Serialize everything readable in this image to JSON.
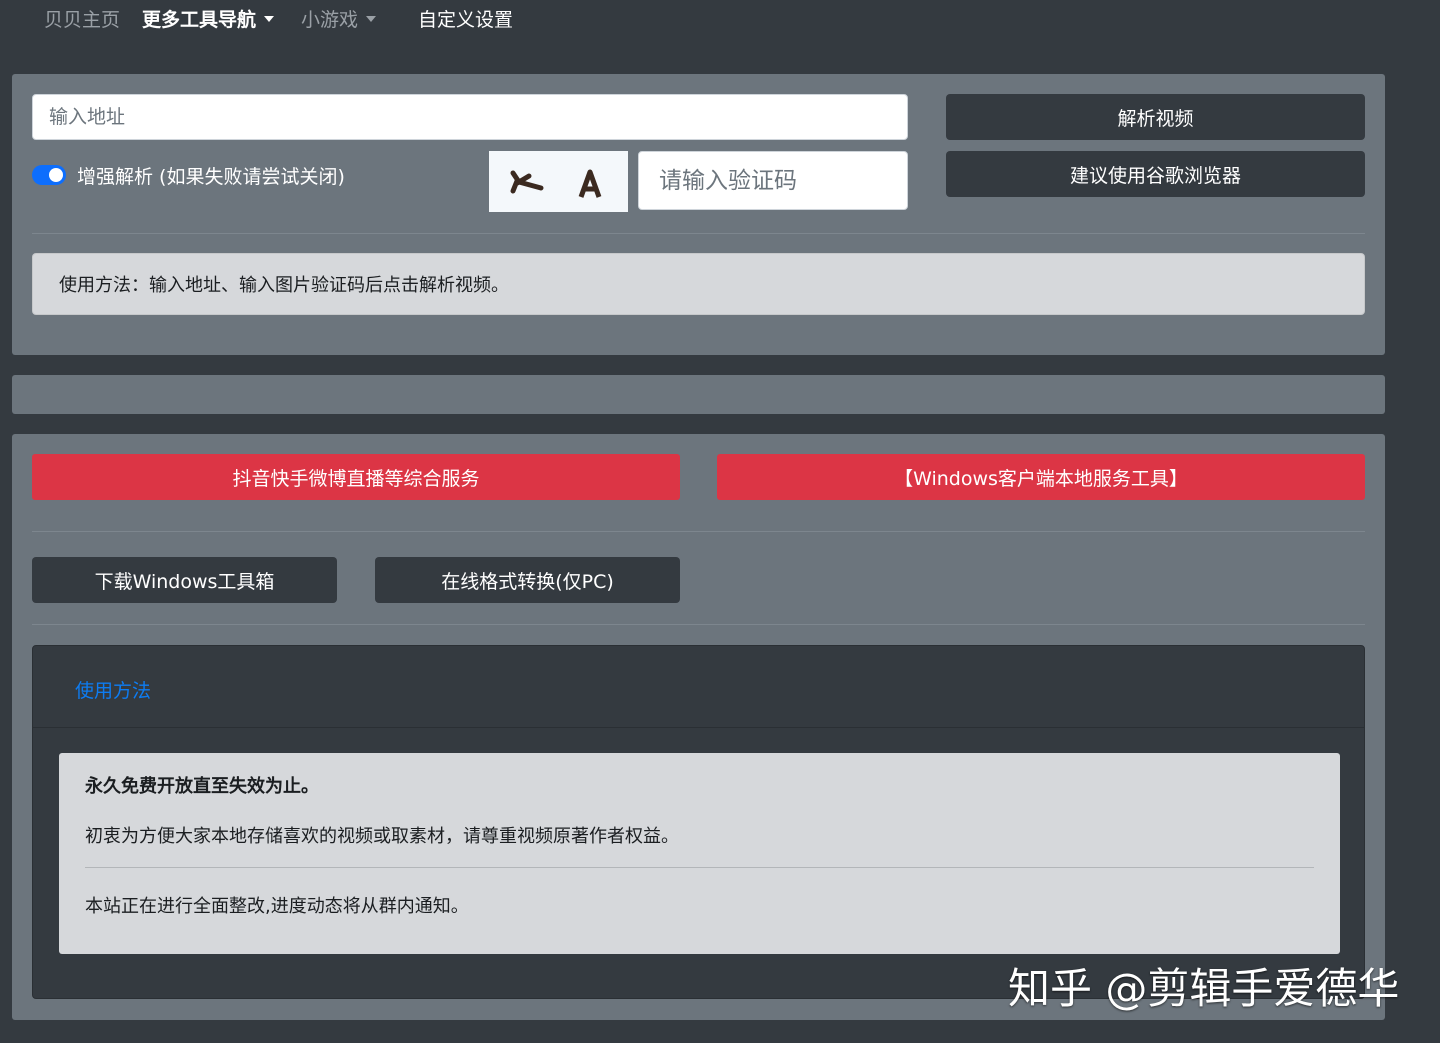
{
  "nav": {
    "items": [
      {
        "label": "贝贝主页"
      },
      {
        "label": "更多工具导航"
      },
      {
        "label": "小游戏"
      },
      {
        "label": "自定义设置"
      }
    ]
  },
  "parser": {
    "url_placeholder": "输入地址",
    "parse_button": "解析视频",
    "browser_button": "建议使用谷歌浏览器",
    "enhance_label": "增强解析 (如果失败请尝试关闭)",
    "enhance_on": true,
    "captcha_chars": [
      "⺊",
      "A"
    ],
    "captcha_placeholder": "请输入验证码",
    "usage_text": "使用方法：输入地址、输入图片验证码后点击解析视频。"
  },
  "services": {
    "red_buttons": [
      "抖音快手微博直播等综合服务",
      "【Windows客户端本地服务工具】"
    ],
    "dark_buttons": [
      "下载Windows工具箱",
      "在线格式转换(仅PC)"
    ]
  },
  "usage_card": {
    "title": "使用方法",
    "lines": [
      "永久免费开放直至失效为止。",
      "初衷为方便大家本地存储喜欢的视频或取素材，请尊重视频原著作者权益。",
      "本站正在进行全面整改,进度动态将从群内通知。"
    ]
  },
  "watermark": "知乎 @剪辑手爱德华",
  "colors": {
    "background": "#343a40",
    "panel": "#6c757d",
    "danger": "#dc3545",
    "primary": "#0d6efd",
    "link": "#0d7cf2"
  }
}
